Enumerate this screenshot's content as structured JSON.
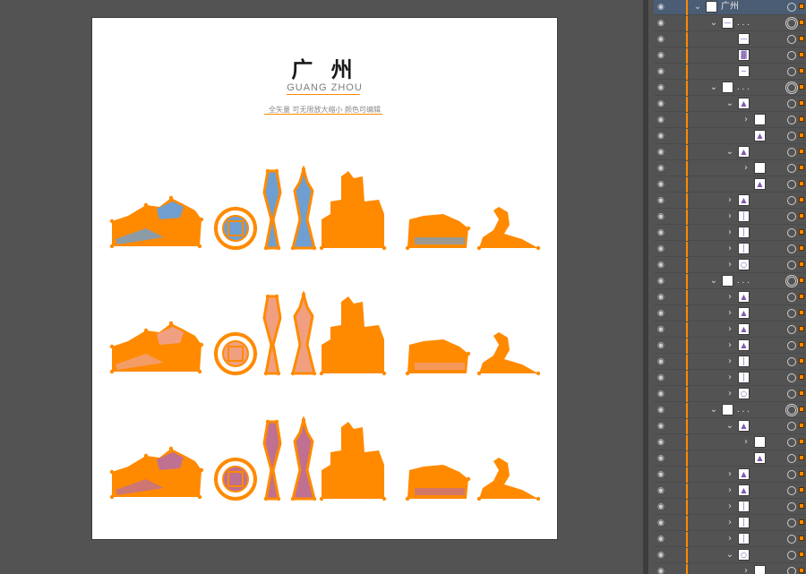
{
  "artboard": {
    "title": "广 州",
    "subtitle": "GUANG ZHOU",
    "note": "全矢量 可无限放大缩小 颜色可编辑"
  },
  "colors": {
    "accent": "#ff8a00",
    "panel_bg": "#535353",
    "selected_row": "#4a5d75",
    "row1_fill": "#6f9fd0",
    "row2_fill": "#f0a080",
    "row3_fill": "#c07090"
  },
  "layers_panel": {
    "rows": [
      {
        "indent": 0,
        "caret": "down",
        "thumb": "blank",
        "name": "广州",
        "selected": true,
        "target": "single"
      },
      {
        "indent": 1,
        "caret": "down",
        "thumb": "text",
        "name": ". . .",
        "selected": false,
        "target": "double"
      },
      {
        "indent": 2,
        "caret": "",
        "thumb": "text",
        "name": "",
        "selected": false,
        "target": "single"
      },
      {
        "indent": 2,
        "caret": "",
        "thumb": "title",
        "name": "",
        "selected": false,
        "target": "single"
      },
      {
        "indent": 2,
        "caret": "",
        "thumb": "line",
        "name": "",
        "selected": false,
        "target": "single"
      },
      {
        "indent": 1,
        "caret": "down",
        "thumb": "blank",
        "name": ". . .",
        "selected": false,
        "target": "double"
      },
      {
        "indent": 2,
        "caret": "down",
        "thumb": "skyline",
        "name": "",
        "selected": false,
        "target": "single"
      },
      {
        "indent": 3,
        "caret": "right",
        "thumb": "blank",
        "name": "",
        "selected": false,
        "target": "single"
      },
      {
        "indent": 3,
        "caret": "",
        "thumb": "skyline",
        "name": "",
        "selected": false,
        "target": "single"
      },
      {
        "indent": 2,
        "caret": "down",
        "thumb": "skyline",
        "name": "",
        "selected": false,
        "target": "single"
      },
      {
        "indent": 3,
        "caret": "right",
        "thumb": "blank",
        "name": "",
        "selected": false,
        "target": "single"
      },
      {
        "indent": 3,
        "caret": "",
        "thumb": "skyline",
        "name": "",
        "selected": false,
        "target": "single"
      },
      {
        "indent": 2,
        "caret": "right",
        "thumb": "skyline",
        "name": "",
        "selected": false,
        "target": "single"
      },
      {
        "indent": 2,
        "caret": "right",
        "thumb": "tower",
        "name": "",
        "selected": false,
        "target": "single"
      },
      {
        "indent": 2,
        "caret": "right",
        "thumb": "tower",
        "name": "",
        "selected": false,
        "target": "single"
      },
      {
        "indent": 2,
        "caret": "right",
        "thumb": "tower",
        "name": "",
        "selected": false,
        "target": "single"
      },
      {
        "indent": 2,
        "caret": "right",
        "thumb": "ring",
        "name": "",
        "selected": false,
        "target": "single"
      },
      {
        "indent": 1,
        "caret": "down",
        "thumb": "blank",
        "name": ". . .",
        "selected": false,
        "target": "double"
      },
      {
        "indent": 2,
        "caret": "right",
        "thumb": "skyline",
        "name": "",
        "selected": false,
        "target": "single"
      },
      {
        "indent": 2,
        "caret": "right",
        "thumb": "skyline",
        "name": "",
        "selected": false,
        "target": "single"
      },
      {
        "indent": 2,
        "caret": "right",
        "thumb": "skyline",
        "name": "",
        "selected": false,
        "target": "single"
      },
      {
        "indent": 2,
        "caret": "right",
        "thumb": "skyline",
        "name": "",
        "selected": false,
        "target": "single"
      },
      {
        "indent": 2,
        "caret": "right",
        "thumb": "tower",
        "name": "",
        "selected": false,
        "target": "single"
      },
      {
        "indent": 2,
        "caret": "right",
        "thumb": "tower",
        "name": "",
        "selected": false,
        "target": "single"
      },
      {
        "indent": 2,
        "caret": "right",
        "thumb": "ring",
        "name": "",
        "selected": false,
        "target": "single"
      },
      {
        "indent": 1,
        "caret": "down",
        "thumb": "blank",
        "name": ". . .",
        "selected": false,
        "target": "double"
      },
      {
        "indent": 2,
        "caret": "down",
        "thumb": "skyline",
        "name": "",
        "selected": false,
        "target": "single"
      },
      {
        "indent": 3,
        "caret": "right",
        "thumb": "blank",
        "name": "",
        "selected": false,
        "target": "single"
      },
      {
        "indent": 3,
        "caret": "",
        "thumb": "skyline",
        "name": "",
        "selected": false,
        "target": "single"
      },
      {
        "indent": 2,
        "caret": "right",
        "thumb": "skyline",
        "name": "",
        "selected": false,
        "target": "single"
      },
      {
        "indent": 2,
        "caret": "right",
        "thumb": "skyline",
        "name": "",
        "selected": false,
        "target": "single"
      },
      {
        "indent": 2,
        "caret": "right",
        "thumb": "tower",
        "name": "",
        "selected": false,
        "target": "single"
      },
      {
        "indent": 2,
        "caret": "right",
        "thumb": "tower",
        "name": "",
        "selected": false,
        "target": "single"
      },
      {
        "indent": 2,
        "caret": "right",
        "thumb": "tower",
        "name": "",
        "selected": false,
        "target": "single"
      },
      {
        "indent": 2,
        "caret": "down",
        "thumb": "ring",
        "name": "",
        "selected": false,
        "target": "single"
      },
      {
        "indent": 3,
        "caret": "right",
        "thumb": "blank",
        "name": "",
        "selected": false,
        "target": "single"
      }
    ]
  }
}
